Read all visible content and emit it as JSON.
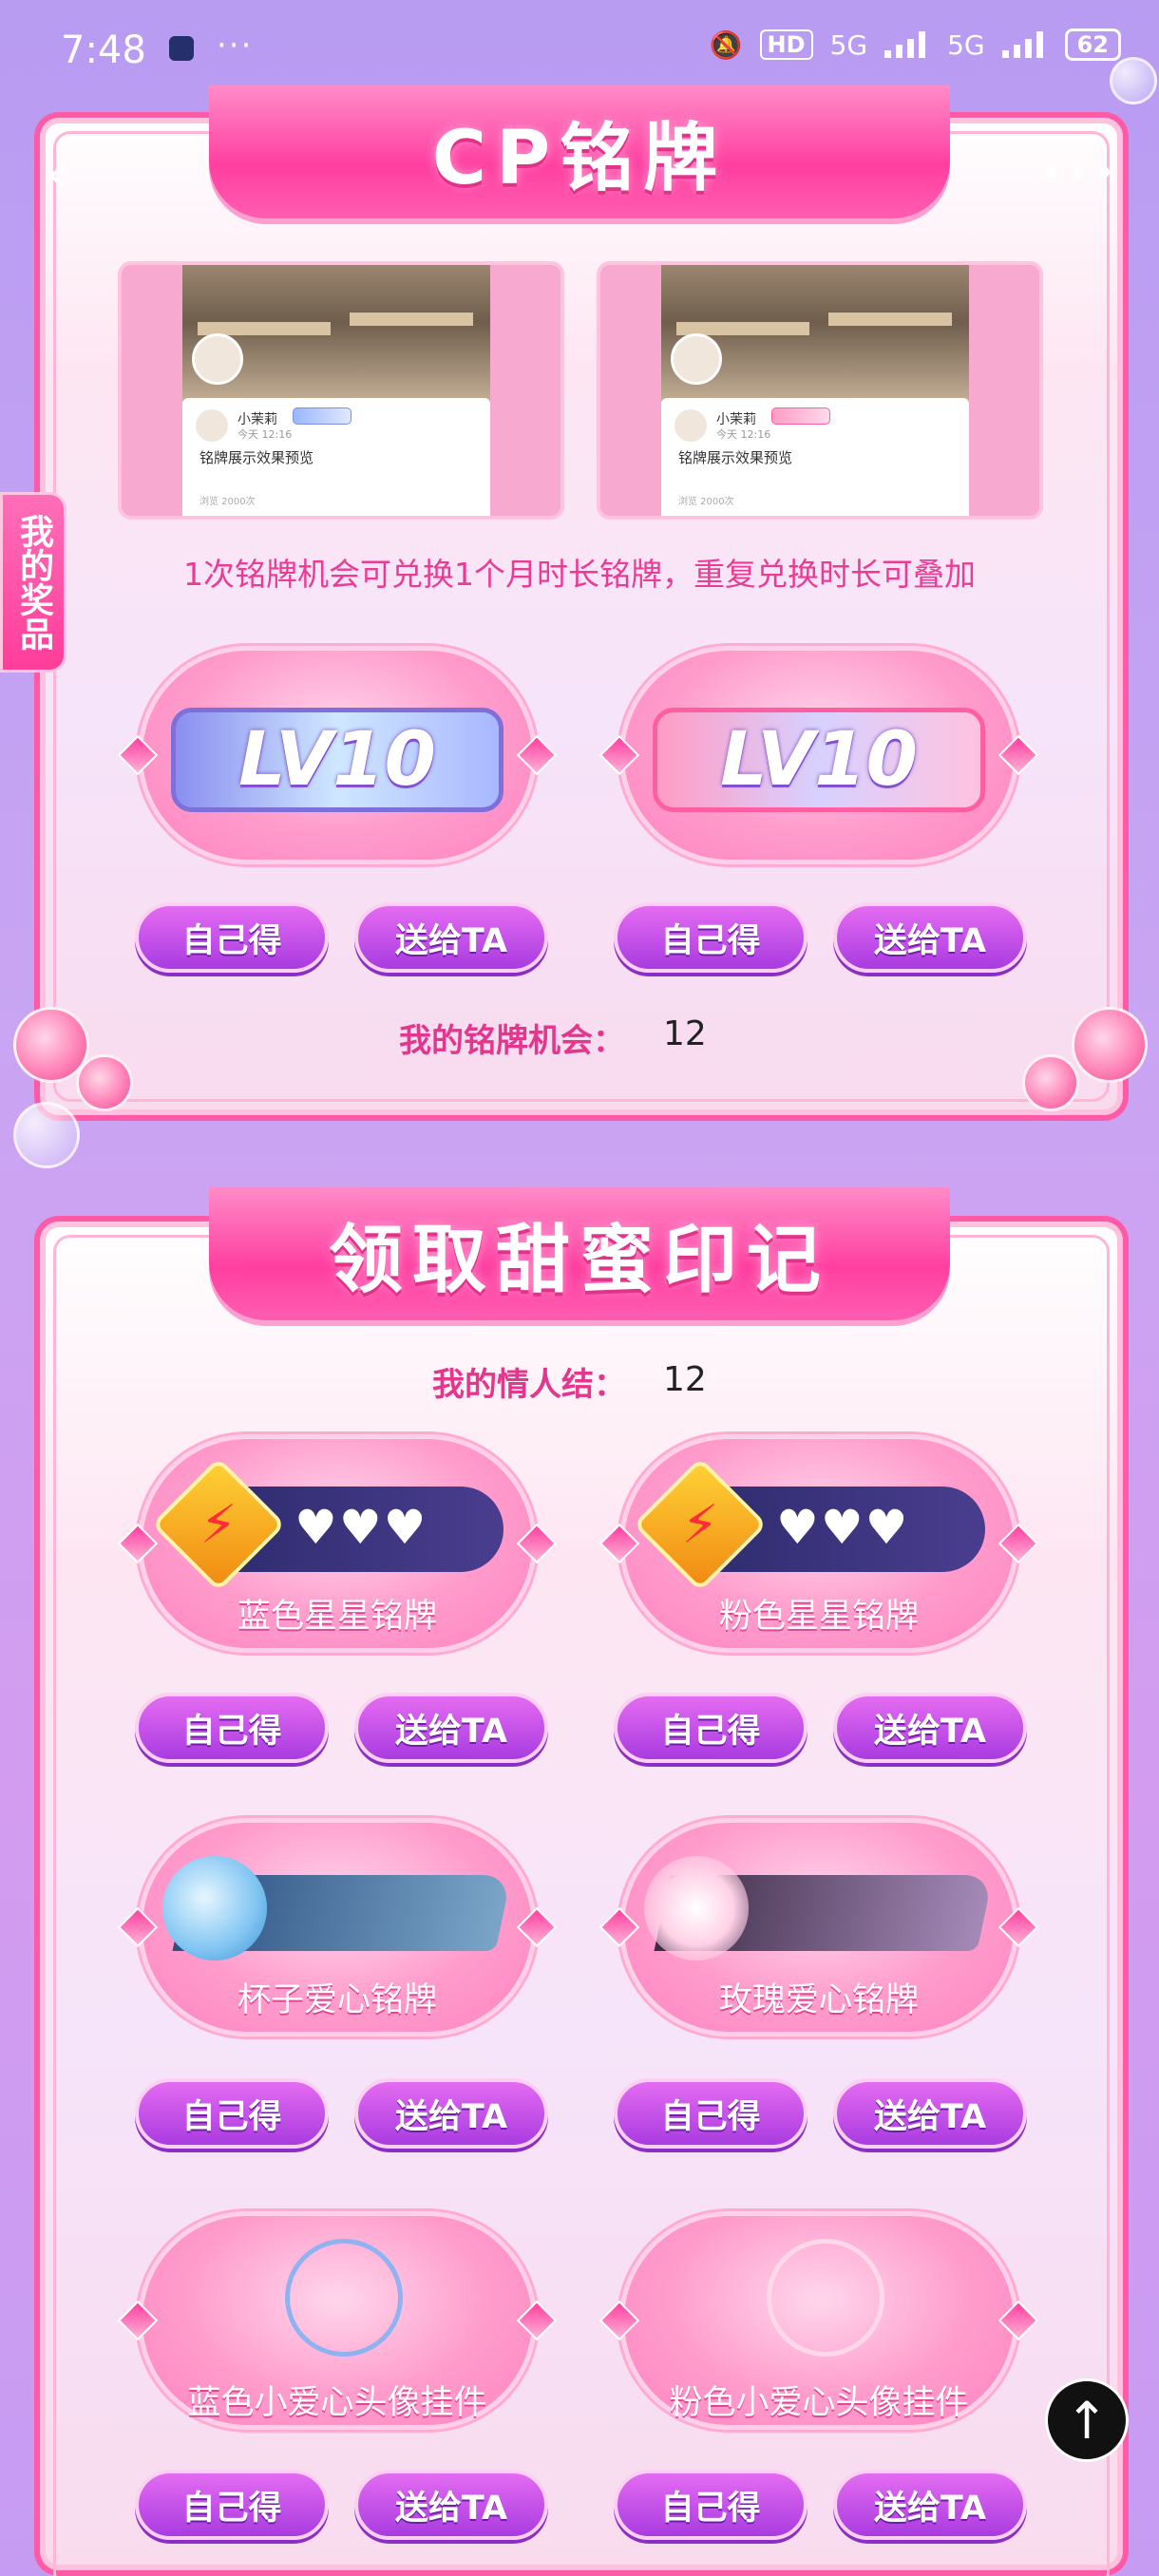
{
  "status_bar": {
    "time": "7:48",
    "dots": "···",
    "network": "HD",
    "signal1": "5G",
    "signal2": "5G",
    "battery": "62"
  },
  "nav": {
    "back_icon": "‹",
    "more_icon": "•••"
  },
  "side_tab": {
    "label": "我的奖品"
  },
  "section1": {
    "title": "CP铭牌",
    "previews": [
      {
        "username": "小茉莉",
        "date": "今天 12:16",
        "text": "铭牌展示效果预览",
        "footer": "浏览 2000次"
      },
      {
        "username": "小茉莉",
        "date": "今天 12:16",
        "text": "铭牌展示效果预览",
        "footer": "浏览 2000次"
      }
    ],
    "rule_text": "1次铭牌机会可兑换1个月时长铭牌，重复兑换时长可叠加",
    "badges": [
      {
        "text": "LV10",
        "variant": "blue"
      },
      {
        "text": "LV10",
        "variant": "pink"
      }
    ],
    "count_label": "我的铭牌机会：",
    "count_value": "12"
  },
  "section2": {
    "title": "领取甜蜜印记",
    "count_label": "我的情人结：",
    "count_value": "12",
    "items": [
      {
        "label": "蓝色星星铭牌"
      },
      {
        "label": "粉色星星铭牌"
      },
      {
        "label": "杯子爱心铭牌"
      },
      {
        "label": "玫瑰爱心铭牌"
      },
      {
        "label": "蓝色小爱心头像挂件"
      },
      {
        "label": "粉色小爱心头像挂件"
      }
    ]
  },
  "buttons": {
    "self": "自己得",
    "gift": "送给TA"
  },
  "scroll_top_icon": "arrow-up-icon",
  "colors": {
    "accent": "#ff3fa0",
    "button": "#a93be0",
    "count_label": "#e2378d"
  }
}
